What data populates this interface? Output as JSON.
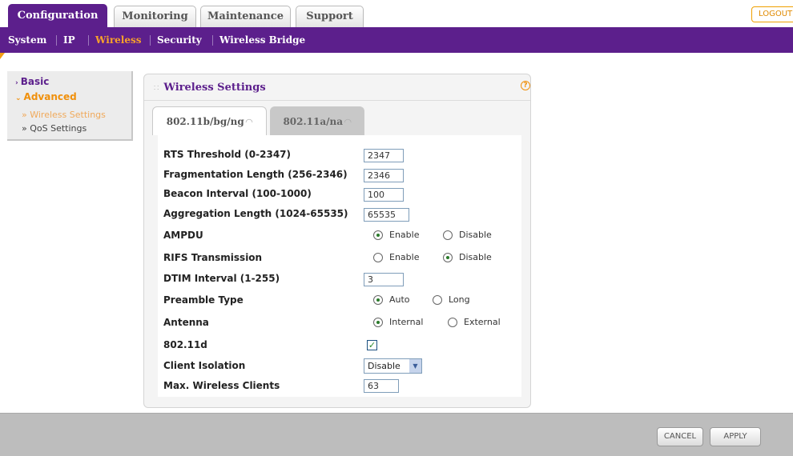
{
  "top_tabs": [
    "Configuration",
    "Monitoring",
    "Maintenance",
    "Support"
  ],
  "logout_label": "LOGOUT",
  "sub_nav": [
    "System",
    "IP",
    "Wireless",
    "Security",
    "Wireless Bridge"
  ],
  "left_menu": {
    "basic": "Basic",
    "advanced": "Advanced",
    "wireless_settings": "Wireless Settings",
    "qos_settings": "QoS Settings"
  },
  "panel": {
    "title": "Wireless Settings",
    "help": "?",
    "tabs": [
      "802.11b/bg/ng",
      "802.11a/na"
    ]
  },
  "form": {
    "rts_label": "RTS Threshold (0-2347)",
    "rts_value": "2347",
    "frag_label": "Fragmentation Length (256-2346)",
    "frag_value": "2346",
    "beacon_label": "Beacon Interval (100-1000)",
    "beacon_value": "100",
    "agg_label": "Aggregation Length (1024-65535)",
    "agg_value": "65535",
    "ampdu_label": "AMPDU",
    "rifs_label": "RIFS Transmission",
    "dtim_label": "DTIM Interval (1-255)",
    "dtim_value": "3",
    "preamble_label": "Preamble Type",
    "antenna_label": "Antenna",
    "d80211_label": "802.11d",
    "isolation_label": "Client Isolation",
    "isolation_value": "Disable",
    "maxclients_label": "Max. Wireless Clients",
    "maxclients_value": "63",
    "enable": "Enable",
    "disable": "Disable",
    "auto": "Auto",
    "long": "Long",
    "internal": "Internal",
    "external": "External"
  },
  "buttons": {
    "cancel": "CANCEL",
    "apply": "APPLY"
  },
  "colors": {
    "brand_purple": "#5c1f8c",
    "accent_orange": "#f7a12b"
  }
}
